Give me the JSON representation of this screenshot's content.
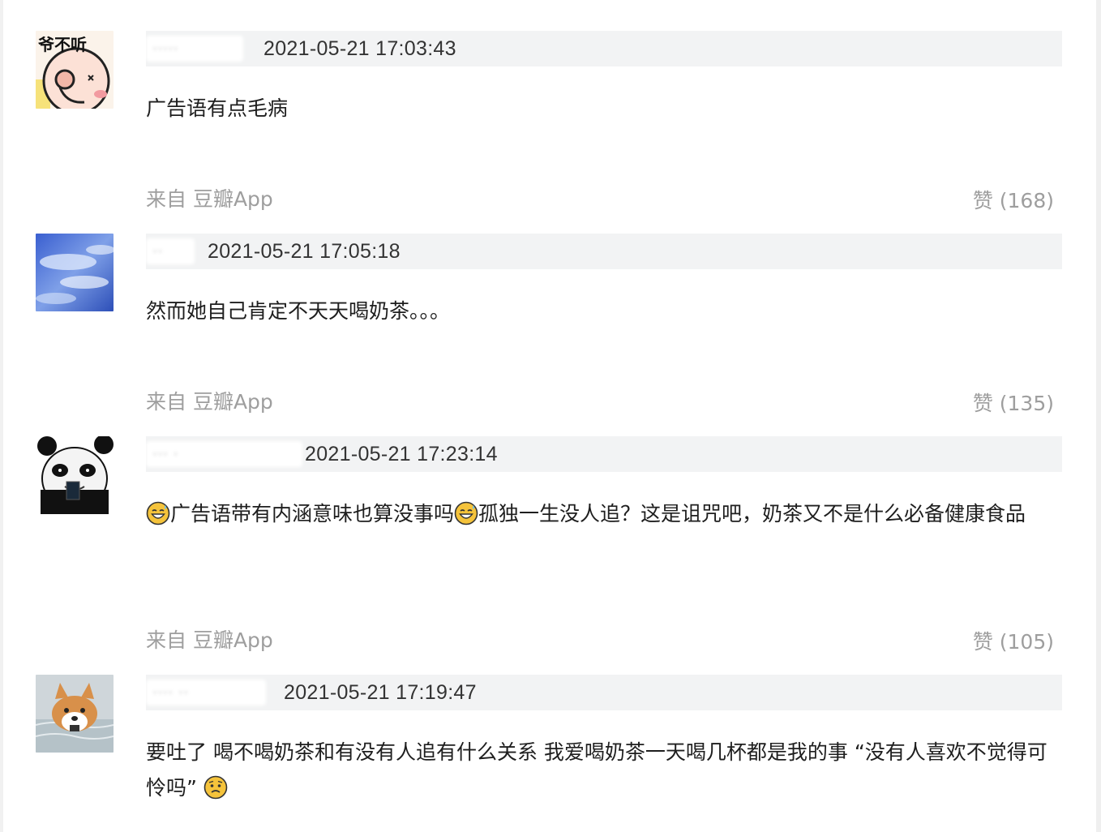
{
  "comments": [
    {
      "username": "·····",
      "timestamp": "2021-05-21 17:03:43",
      "text_parts": [
        "广告语有点毛病"
      ],
      "source": "来自 豆瓣App",
      "likes": "赞 (168)",
      "avatar": {
        "icon": "cartoon-face-icon",
        "overlay_text": "爷不听"
      }
    },
    {
      "username": "··",
      "timestamp": "2021-05-21 17:05:18",
      "text_parts": [
        "然而她自己肯定不天天喝奶茶。。。"
      ],
      "source": "来自 豆瓣App",
      "likes": "赞 (135)",
      "avatar": {
        "icon": "blue-sky-icon"
      }
    },
    {
      "username": "··· ·",
      "timestamp": "2021-05-21 17:23:14",
      "text_parts": [
        "广告语带有内涵意味也算没事吗",
        "孤独一生没人追？这是诅咒吧，奶茶又不是什么必备健康食品"
      ],
      "source": "来自 豆瓣App",
      "likes": "赞 (105)",
      "avatar": {
        "icon": "panda-meme-icon"
      }
    },
    {
      "username": "···· ··",
      "timestamp": "2021-05-21 17:19:47",
      "text_parts": [
        "要吐了 喝不喝奶茶和有没有人追有什么关系 我爱喝奶茶一天喝几杯都是我的事 “没有人喜欢不觉得可怜吗”"
      ],
      "avatar": {
        "icon": "corgi-dog-icon"
      }
    }
  ],
  "colors": {
    "header_bg": "#f2f3f4",
    "meta_text": "#9e9e9e",
    "emoji_yellow": "#f5c33b"
  }
}
